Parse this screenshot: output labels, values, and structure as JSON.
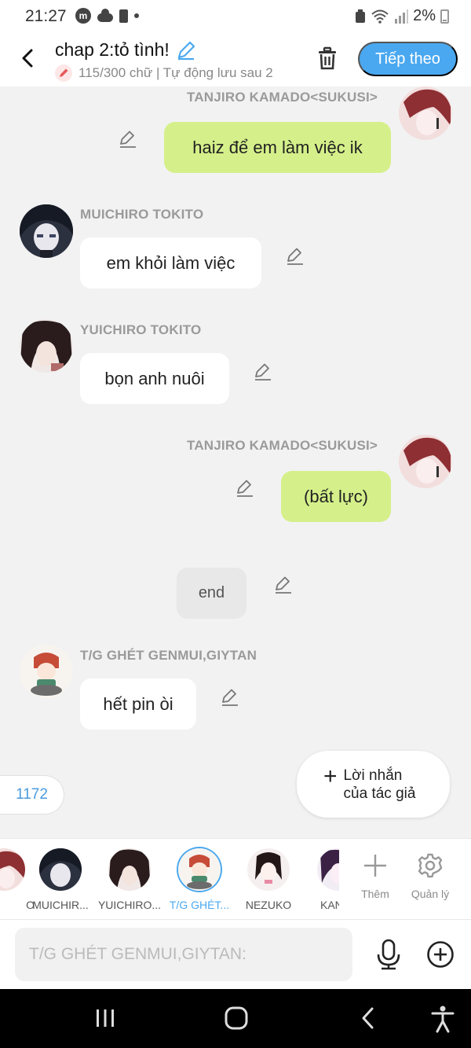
{
  "status_bar": {
    "time": "21:27",
    "app_badge": "m",
    "battery": "2%"
  },
  "header": {
    "title": "chap 2:tỏ tình!",
    "subtitle": "115/300 chữ | Tự động lưu sau 2",
    "next_label": "Tiếp theo"
  },
  "messages": [
    {
      "speaker": "TANJIRO KAMADO<SUKUSI>",
      "text": "haiz để em làm việc ik",
      "side": "right",
      "style": "green"
    },
    {
      "speaker": "MUICHIRO TOKITO",
      "text": "em khỏi làm việc",
      "side": "left",
      "style": "white"
    },
    {
      "speaker": "YUICHIRO TOKITO",
      "text": "bọn anh nuôi",
      "side": "left",
      "style": "white"
    },
    {
      "speaker": "TANJIRO KAMADO<SUKUSI>",
      "text": "(bất lực)",
      "side": "right",
      "style": "green"
    },
    {
      "speaker": "",
      "text": "end",
      "side": "center",
      "style": "grey"
    },
    {
      "speaker": "T/G GHÉT GENMUI,GIYTAN",
      "text": "hết pin òi",
      "side": "left",
      "style": "white"
    }
  ],
  "counter": "1172",
  "author_note": {
    "line1": "Lời nhắn",
    "line2": "của tác giả"
  },
  "characters": [
    {
      "label": "O"
    },
    {
      "label": "MUICHIR..."
    },
    {
      "label": "YUICHIRO..."
    },
    {
      "label": "T/G GHÉT..."
    },
    {
      "label": "NEZUKO"
    },
    {
      "label": "KAN"
    }
  ],
  "tools": {
    "add": "Thêm",
    "manage": "Quản lý"
  },
  "input": {
    "placeholder": "T/G GHÉT GENMUI,GIYTAN:"
  },
  "colors": {
    "accent": "#4aa8f0",
    "green_bubble": "#d5f08a",
    "background": "#f2f2f2"
  }
}
